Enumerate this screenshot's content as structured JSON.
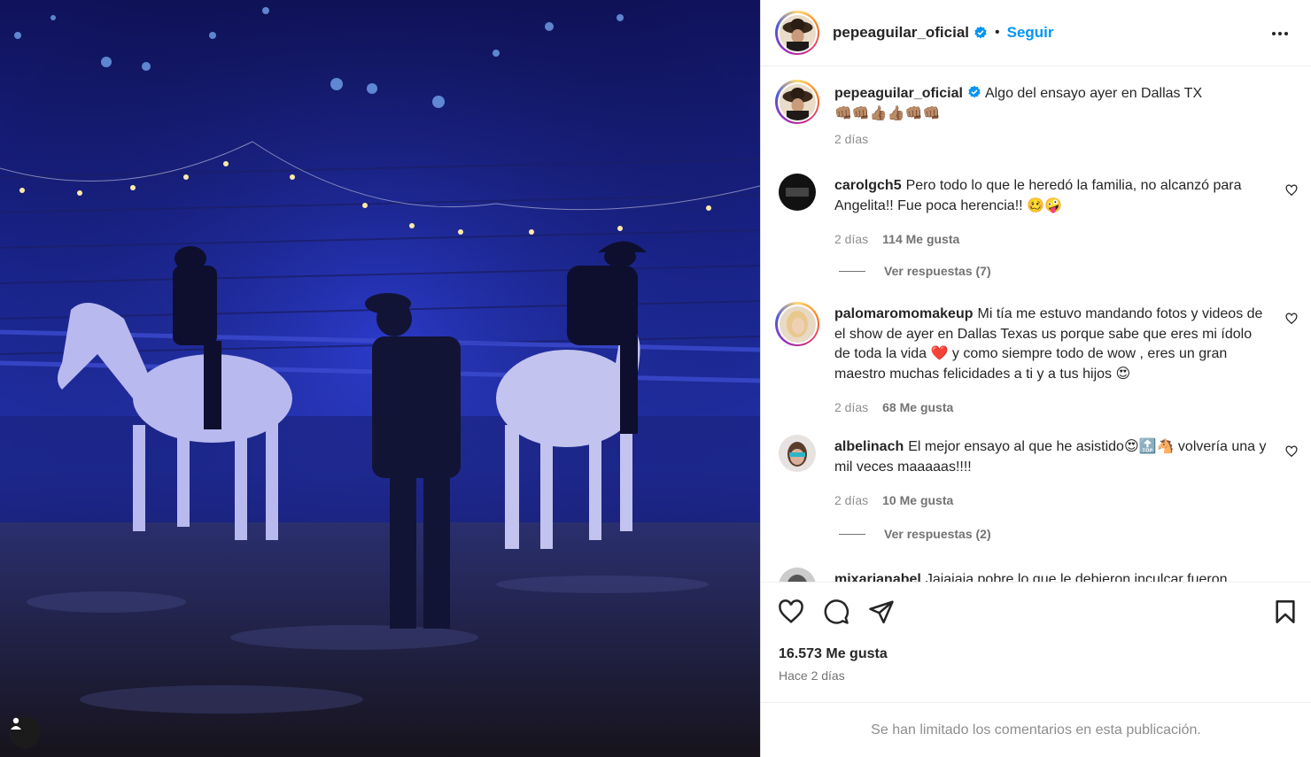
{
  "post_owner": {
    "username": "pepeaguilar_oficial",
    "separator": "•",
    "follow_label": "Seguir"
  },
  "caption": {
    "username": "pepeaguilar_oficial",
    "text": "Algo del ensayo ayer en Dallas TX",
    "emojis": "👊🏽👊🏽👍🏽👍🏽👊🏽👊🏽",
    "time": "2 días"
  },
  "comments": [
    {
      "username": "carolgch5",
      "text": "Pero todo lo que le heredó la familia, no alcanzó para Angelita!! Fue poca herencia!! 🥴🤪",
      "time": "2 días",
      "likes": "114 Me gusta",
      "replies": "Ver respuestas (7)"
    },
    {
      "username": "palomaromomakeup",
      "text": "Mi tía me estuvo mandando fotos y videos de el show de ayer en Dallas Texas us porque sabe que eres mi ídolo de toda la vida ❤️ y como siempre todo de wow , eres un gran maestro muchas felicidades a ti y a tus hijos 😍",
      "time": "2 días",
      "likes": "68 Me gusta"
    },
    {
      "username": "albelinach",
      "text": "El mejor ensayo al que he asistido😍🔝🐴 volvería una y mil veces maaaaas!!!!",
      "time": "2 días",
      "likes": "10 Me gusta",
      "replies": "Ver respuestas (2)"
    },
    {
      "username": "mixarianabel",
      "text": "Jajajaja pobre lo que le debieron inculcar fueron"
    }
  ],
  "footer": {
    "likes_total": "16.573 Me gusta",
    "posted": "Hace 2 días",
    "limited_notice": "Se han limitado los comentarios en esta publicación."
  },
  "colors": {
    "accent": "#0095f6",
    "verified": "#0095f6",
    "muted_text": "#737373",
    "stage_blue": "#1a2a9a"
  },
  "icons": [
    "heart-icon",
    "comment-icon",
    "share-icon",
    "bookmark-icon",
    "more-options-icon",
    "verified-icon",
    "user-tag-icon"
  ]
}
